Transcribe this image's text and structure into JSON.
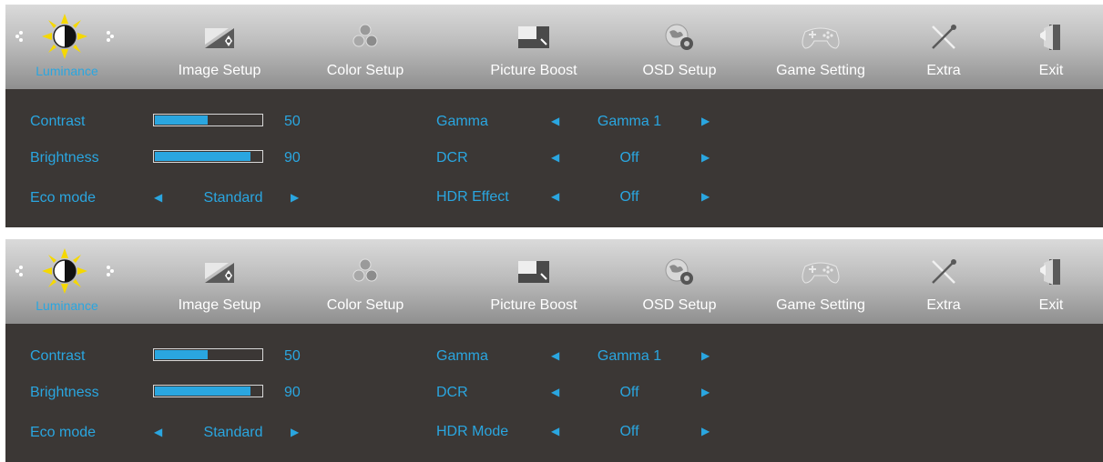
{
  "colors": {
    "accent": "#2aa6e0",
    "panel_bg": "#3b3735",
    "header_top": "#dadada",
    "header_bottom": "#8f8f8f"
  },
  "panels": [
    {
      "tabs": [
        {
          "label": "Luminance",
          "icon": "sun-icon",
          "active": true
        },
        {
          "label": "Image Setup",
          "icon": "image-setup-icon"
        },
        {
          "label": "Color Setup",
          "icon": "color-setup-icon"
        },
        {
          "label": "Picture Boost",
          "icon": "picture-boost-icon"
        },
        {
          "label": "OSD Setup",
          "icon": "osd-setup-icon"
        },
        {
          "label": "Game Setting",
          "icon": "gamepad-icon"
        },
        {
          "label": "Extra",
          "icon": "tools-icon"
        },
        {
          "label": "Exit",
          "icon": "exit-door-icon"
        }
      ],
      "contrast": {
        "label": "Contrast",
        "value": "50",
        "level": 0.5
      },
      "brightness": {
        "label": "Brightness",
        "value": "90",
        "level": 0.9
      },
      "eco_mode": {
        "label": "Eco mode",
        "value": "Standard"
      },
      "gamma": {
        "label": "Gamma",
        "value": "Gamma 1"
      },
      "dcr": {
        "label": "DCR",
        "value": "Off"
      },
      "hdr": {
        "label": "HDR Effect",
        "value": "Off"
      }
    },
    {
      "tabs": [
        {
          "label": "Luminance",
          "icon": "sun-icon",
          "active": true
        },
        {
          "label": "Image Setup",
          "icon": "image-setup-icon"
        },
        {
          "label": "Color Setup",
          "icon": "color-setup-icon"
        },
        {
          "label": "Picture Boost",
          "icon": "picture-boost-icon"
        },
        {
          "label": "OSD Setup",
          "icon": "osd-setup-icon"
        },
        {
          "label": "Game Setting",
          "icon": "gamepad-icon"
        },
        {
          "label": "Extra",
          "icon": "tools-icon"
        },
        {
          "label": "Exit",
          "icon": "exit-door-icon"
        }
      ],
      "contrast": {
        "label": "Contrast",
        "value": "50",
        "level": 0.5
      },
      "brightness": {
        "label": "Brightness",
        "value": "90",
        "level": 0.9
      },
      "eco_mode": {
        "label": "Eco mode",
        "value": "Standard"
      },
      "gamma": {
        "label": "Gamma",
        "value": "Gamma 1"
      },
      "dcr": {
        "label": "DCR",
        "value": "Off"
      },
      "hdr": {
        "label": "HDR Mode",
        "value": "Off"
      }
    }
  ]
}
